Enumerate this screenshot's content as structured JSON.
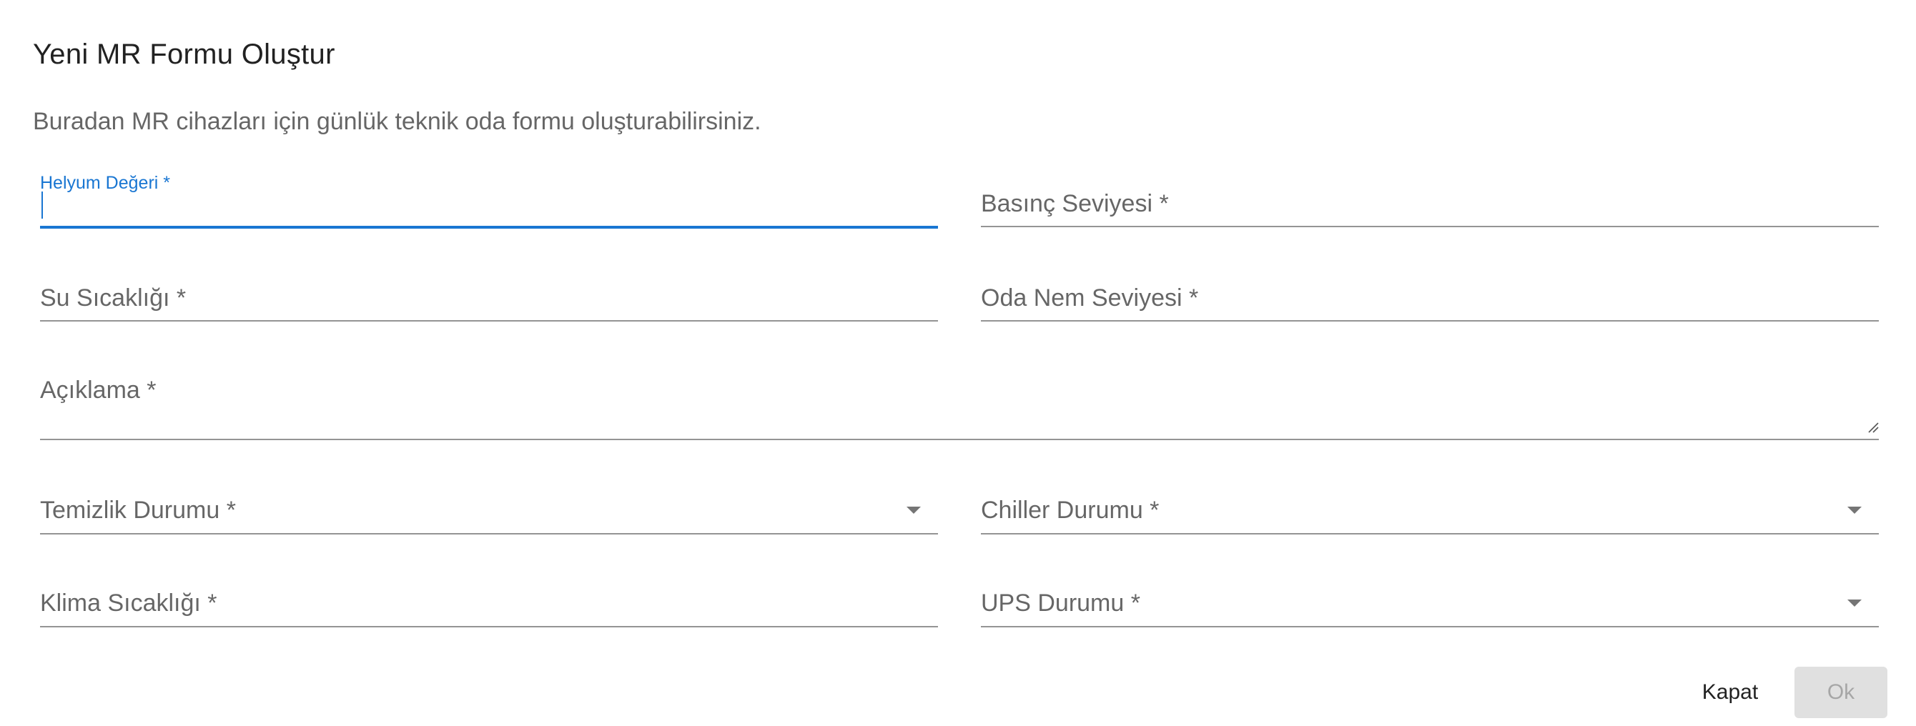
{
  "dialog": {
    "title": "Yeni MR Formu Oluştur",
    "subtitle": "Buradan MR cihazları için günlük teknik oda formu oluşturabilirsiniz."
  },
  "form": {
    "helium": {
      "label": "Helyum Değeri *",
      "value": ""
    },
    "pressure": {
      "label": "Basınç Seviyesi *",
      "value": ""
    },
    "water_temp": {
      "label": "Su Sıcaklığı *",
      "value": ""
    },
    "room_humidity": {
      "label": "Oda Nem Seviyesi *",
      "value": ""
    },
    "description": {
      "label": "Açıklama *",
      "value": ""
    },
    "cleaning_status": {
      "label": "Temizlik Durumu *",
      "value": ""
    },
    "chiller_status": {
      "label": "Chiller Durumu *",
      "value": ""
    },
    "ac_temp": {
      "label": "Klima Sıcaklığı *",
      "value": ""
    },
    "ups_status": {
      "label": "UPS Durumu *",
      "value": ""
    }
  },
  "actions": {
    "close_label": "Kapat",
    "ok_label": "Ok"
  },
  "colors": {
    "accent": "#1976d2",
    "disabled_bg": "#e0e0e0"
  }
}
